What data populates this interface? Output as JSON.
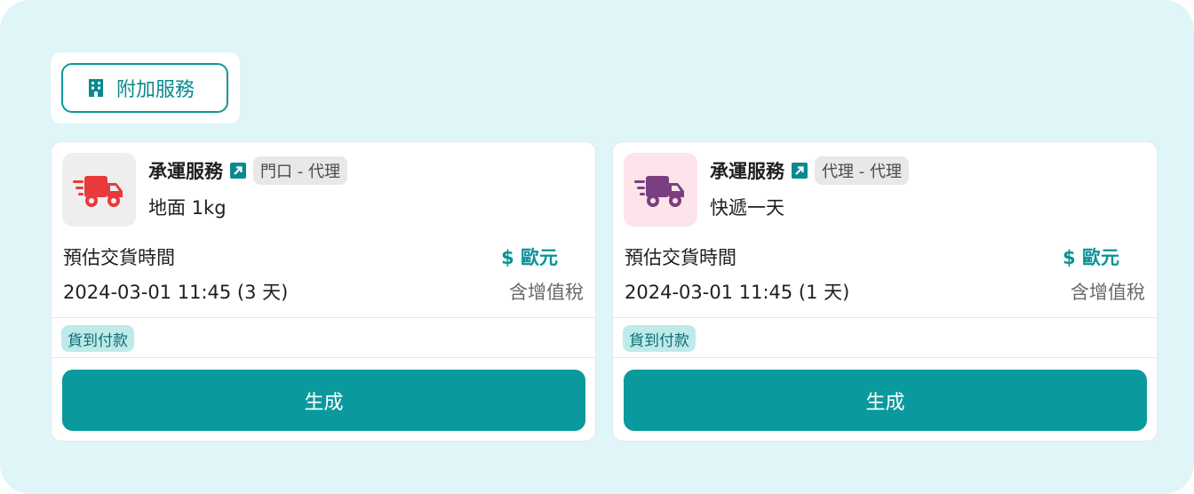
{
  "tab": {
    "label": "附加服務"
  },
  "cards": [
    {
      "title": "承運服務",
      "route_chip": "門口 - 代理",
      "service": "地面 1kg",
      "eta_label": "預估交貨時間",
      "eta_value": "2024-03-01 11:45 (3 天)",
      "price": "$ 歐元",
      "vat": "含增值稅",
      "payment_badge": "貨到付款",
      "action_label": "生成",
      "icon": "delivery-truck-icon",
      "icon_color": "#e83a3a",
      "tile_bg": "#eeeeee"
    },
    {
      "title": "承運服務",
      "route_chip": "代理 - 代理",
      "service": "快遞一天",
      "eta_label": "預估交貨時間",
      "eta_value": "2024-03-01 11:45 (1 天)",
      "price": "$ 歐元",
      "vat": "含增值稅",
      "payment_badge": "貨到付款",
      "action_label": "生成",
      "icon": "delivery-truck-icon",
      "icon_color": "#7a3f80",
      "tile_bg": "#fde4ea"
    }
  ],
  "colors": {
    "accent": "#0a9a9d",
    "panel_bg": "#dff5f8"
  }
}
